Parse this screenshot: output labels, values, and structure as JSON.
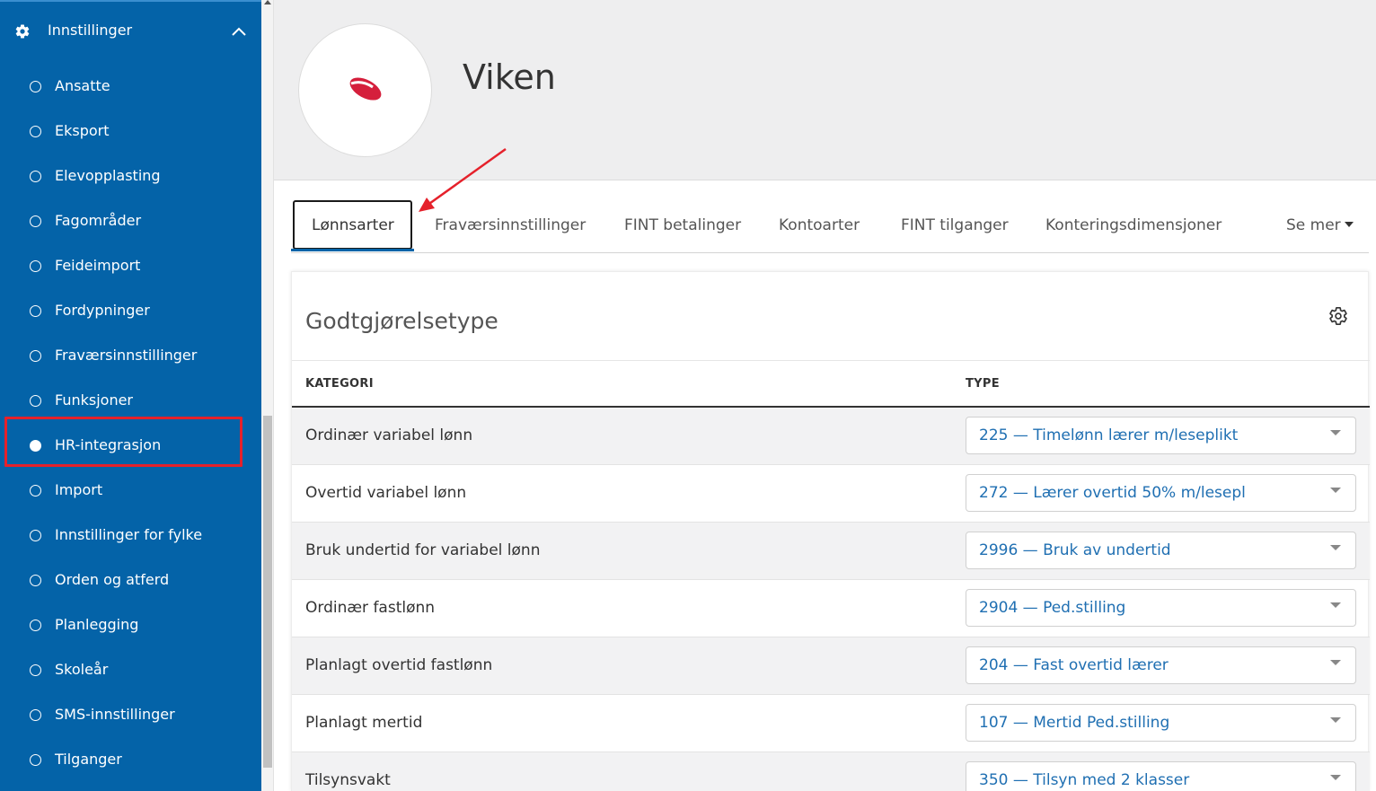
{
  "sidebar": {
    "section_title": "Innstillinger",
    "items": [
      {
        "label": "Ansatte",
        "active": false
      },
      {
        "label": "Eksport",
        "active": false
      },
      {
        "label": "Elevopplasting",
        "active": false
      },
      {
        "label": "Fagområder",
        "active": false
      },
      {
        "label": "Feideimport",
        "active": false
      },
      {
        "label": "Fordypninger",
        "active": false
      },
      {
        "label": "Fraværsinnstillinger",
        "active": false
      },
      {
        "label": "Funksjoner",
        "active": false
      },
      {
        "label": "HR-integrasjon",
        "active": true
      },
      {
        "label": "Import",
        "active": false
      },
      {
        "label": "Innstillinger for fylke",
        "active": false
      },
      {
        "label": "Orden og atferd",
        "active": false
      },
      {
        "label": "Planlegging",
        "active": false
      },
      {
        "label": "Skoleår",
        "active": false
      },
      {
        "label": "SMS-innstillinger",
        "active": false
      },
      {
        "label": "Tilganger",
        "active": false
      }
    ]
  },
  "header": {
    "org_name": "Viken"
  },
  "tabs": {
    "items": [
      {
        "label": "Lønnsarter",
        "active": true
      },
      {
        "label": "Fraværsinnstillinger",
        "active": false
      },
      {
        "label": "FINT betalinger",
        "active": false
      },
      {
        "label": "Kontoarter",
        "active": false
      },
      {
        "label": "FINT tilganger",
        "active": false
      },
      {
        "label": "Konteringsdimensjoner",
        "active": false
      }
    ],
    "more_label": "Se mer"
  },
  "card": {
    "title": "Godtgjørelsetype",
    "columns": {
      "category": "KATEGORI",
      "type": "TYPE"
    },
    "rows": [
      {
        "category": "Ordinær variabel lønn",
        "type": "225 — Timelønn lærer m/leseplikt"
      },
      {
        "category": "Overtid variabel lønn",
        "type": "272 — Lærer overtid 50% m/lesepl"
      },
      {
        "category": "Bruk undertid for variabel lønn",
        "type": "2996 — Bruk av undertid"
      },
      {
        "category": "Ordinær fastlønn",
        "type": "2904 — Ped.stilling"
      },
      {
        "category": "Planlagt overtid fastlønn",
        "type": "204 — Fast overtid lærer"
      },
      {
        "category": "Planlagt mertid",
        "type": "107 — Mertid Ped.stilling"
      },
      {
        "category": "Tilsynsvakt",
        "type": "350 — Tilsyn med 2 klasser"
      }
    ]
  },
  "colors": {
    "sidebar_bg": "#0463a8",
    "accent": "#0463a8",
    "highlight_red": "#e5212b",
    "link_blue": "#1f6fb2"
  }
}
